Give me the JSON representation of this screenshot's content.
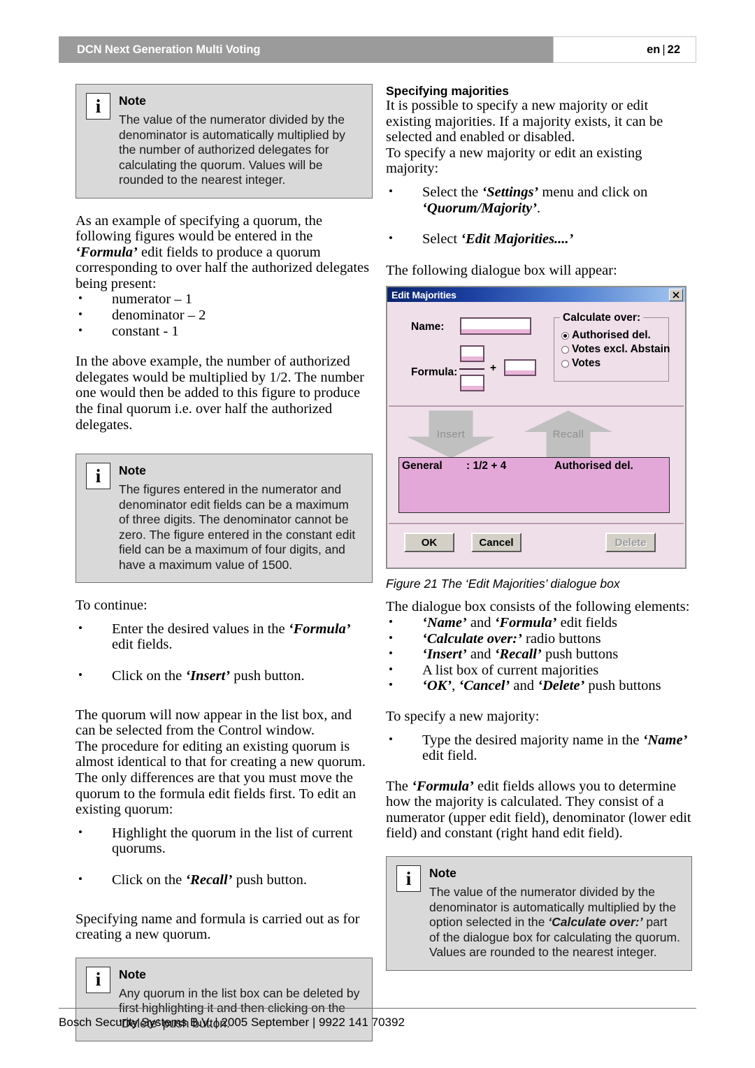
{
  "header": {
    "title": "DCN Next Generation Multi Voting",
    "language": "en",
    "separator": "|",
    "page_number": "22"
  },
  "note_icon_glyph": "i",
  "note_label": "Note",
  "left_column": {
    "note1": {
      "title": "Note",
      "text": "The value of the numerator divided by the denominator is automatically multiplied by the number of authorized delegates for calculating the quorum. Values will be rounded to the nearest integer."
    },
    "para1_a": "As an example of specifying a quorum, the following figures would be entered in the ",
    "para1_em": "‘Formula’",
    "para1_b": " edit fields to produce a quorum corresponding to over half the authorized delegates being present:",
    "list1": [
      "numerator – 1",
      "denominator – 2",
      "constant - 1"
    ],
    "para2": "In the above example, the number of authorized delegates would be multiplied by 1/2. The number one would then be added to this figure to produce the final quorum i.e. over half the authorized delegates.",
    "note2": {
      "title": "Note",
      "text": "The figures entered in the numerator and denominator edit fields can be a maximum of three digits. The denominator cannot be zero. The figure entered in the constant edit field can be a maximum of four digits, and have a maximum value of 1500."
    },
    "para3": "To continue:",
    "list2_item1_a": "Enter the desired values in the ",
    "list2_item1_em": "‘Formula’",
    "list2_item1_b": " edit fields.",
    "list2_item2_a": "Click on the ",
    "list2_item2_em": "‘Insert’",
    "list2_item2_b": " push button.",
    "para4": "The quorum will now appear in the list box, and can be selected from the Control window.",
    "para5": "The procedure for editing an existing quorum is almost identical to that for creating a new quorum. The only differences are that you must move the quorum to the formula edit fields first. To edit an existing quorum:",
    "list3_item1": "Highlight the quorum in the list of current quorums.",
    "list3_item2_a": "Click on the ",
    "list3_item2_em": "‘Recall’",
    "list3_item2_b": " push button.",
    "para6": "Specifying name and formula is carried out as for creating a new quorum.",
    "note3": {
      "title": "Note",
      "text": "Any quorum in the list box can be deleted by first highlighting it and then clicking on the ‘Delete’ push button."
    }
  },
  "right_column": {
    "heading": "Specifying majorities",
    "para1": "It is possible to specify a new majority or edit existing majorities. If a majority exists, it can be selected and enabled or disabled.",
    "para2": "To specify a new majority or edit an existing majority:",
    "list1_item1_a": "Select the ",
    "list1_item1_em": "‘Settings’",
    "list1_item1_b": " menu and click on ",
    "list1_item1_em2": "‘Quorum/Majority’",
    "list1_item1_c": ".",
    "list1_item2_a": "Select ",
    "list1_item2_em": "‘Edit Majorities....’",
    "para3": "The following dialogue box will appear:",
    "figure_caption": "Figure 21 The ‘Edit Majorities’ dialogue box",
    "para4": "The dialogue box consists of the following elements:",
    "elements_list": [
      {
        "em1": "‘Name’",
        "mid": " and ",
        "em2": "‘Formula’",
        "tail": " edit fields"
      },
      {
        "em1": "‘Calculate over:’",
        "mid": "",
        "em2": "",
        "tail": " radio buttons"
      },
      {
        "em1": "‘Insert’",
        "mid": " and ",
        "em2": "‘Recall’",
        "tail": " push buttons"
      },
      {
        "em1": "",
        "mid": "",
        "em2": "",
        "tail": "A list box of current majorities"
      },
      {
        "em1": "‘OK’",
        "mid": ", ",
        "em2": "‘Cancel’",
        "tail": " and ",
        "em3": "‘Delete’",
        "tail2": " push buttons"
      }
    ],
    "para5": "To specify a new majority:",
    "list2_item1_a": "Type the desired majority name in the ",
    "list2_item1_em": "‘Name’",
    "list2_item1_b": " edit field.",
    "para6": "The ",
    "para6_em": "‘Formula’",
    "para6_b": " edit fields allows you to determine how the majority is calculated. They consist of a numerator (upper edit field), denominator (lower edit field) and constant (right hand edit field).",
    "note1": {
      "title": "Note",
      "text_a": "The value of the numerator divided by the denominator is automatically multiplied by the option selected in the ",
      "text_em": "‘Calculate over:’",
      "text_b": " part of the dialogue box for calculating the quorum. Values are rounded to the nearest integer."
    }
  },
  "dialog": {
    "title": "Edit Majorities",
    "close_glyph": "✕",
    "name_label": "Name:",
    "name_value": "",
    "formula_label": "Formula:",
    "numerator_value": "",
    "denominator_value": "",
    "plus_sign": "+",
    "constant_value": "",
    "group_legend": "Calculate over:",
    "radios": [
      {
        "label": "Authorised del.",
        "checked": true
      },
      {
        "label": "Votes excl. Abstain",
        "checked": false
      },
      {
        "label": "Votes",
        "checked": false
      }
    ],
    "insert_label": "Insert",
    "recall_label": "Recall",
    "listbox_rows": [
      {
        "name": "General",
        "formula": ": 1/2 + 4",
        "over": "Authorised del."
      }
    ],
    "ok_label": "OK",
    "cancel_label": "Cancel",
    "delete_label": "Delete"
  },
  "footer": {
    "text": "Bosch Security Systems B.V. | 2005 September | 9922 141 70392"
  },
  "colors": {
    "header_band": "#9b9b9b",
    "note_bg": "#d9d9d9",
    "dialog_bg": "#eedfe9",
    "listbox_bg": "#e3a8d8",
    "titlebar_start": "#0a246a",
    "titlebar_end": "#a6c8ef"
  }
}
